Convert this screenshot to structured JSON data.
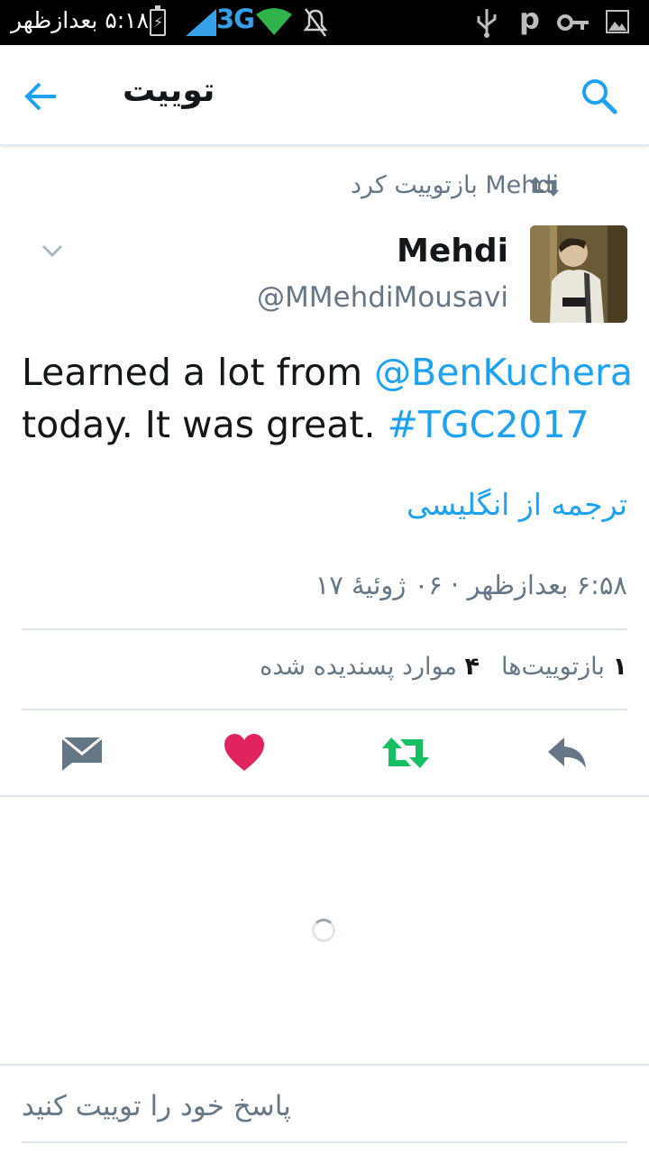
{
  "status_bar": {
    "time": "۵:۱۸ بعدازظهر",
    "network": "3G",
    "icons": [
      "battery-charging-icon",
      "signal-icon",
      "wifi-icon",
      "mute-icon",
      "usb-icon",
      "p-icon",
      "key-icon",
      "image-icon"
    ],
    "network_color": "#36a0e8"
  },
  "appbar": {
    "title": "توییت",
    "back_icon": "arrow-left-icon",
    "search_icon": "search-icon"
  },
  "tweet": {
    "retweeted_by": "Mehdi بازتوییت کرد",
    "author_name": "Mehdi",
    "author_handle": "@MMehdiMousavi",
    "text_prefix": "Learned a lot from ",
    "mention": "@BenKuchera",
    "text_middle": " today. It was great. ",
    "hashtag": "#TGC2017",
    "translate_label": "ترجمه از انگلیسی",
    "timestamp": "۶:۵۸ بعدازظهر · ۰۶ ژوئیهٔ ۱۷",
    "retweet_count": "۱",
    "retweet_label": "بازتوییت‌ها",
    "like_count": "۴",
    "like_label": "موارد پسندیده شده"
  },
  "actions": {
    "reply_icon": "reply-icon",
    "retweet_icon": "retweet-icon",
    "like_icon": "heart-icon",
    "dm_icon": "envelope-icon"
  },
  "reply": {
    "placeholder": "پاسخ خود را توییت کنید"
  },
  "colors": {
    "accent": "#1da1f2",
    "like": "#e0245e",
    "retweet": "#17bf63",
    "secondary_text": "#657786"
  }
}
